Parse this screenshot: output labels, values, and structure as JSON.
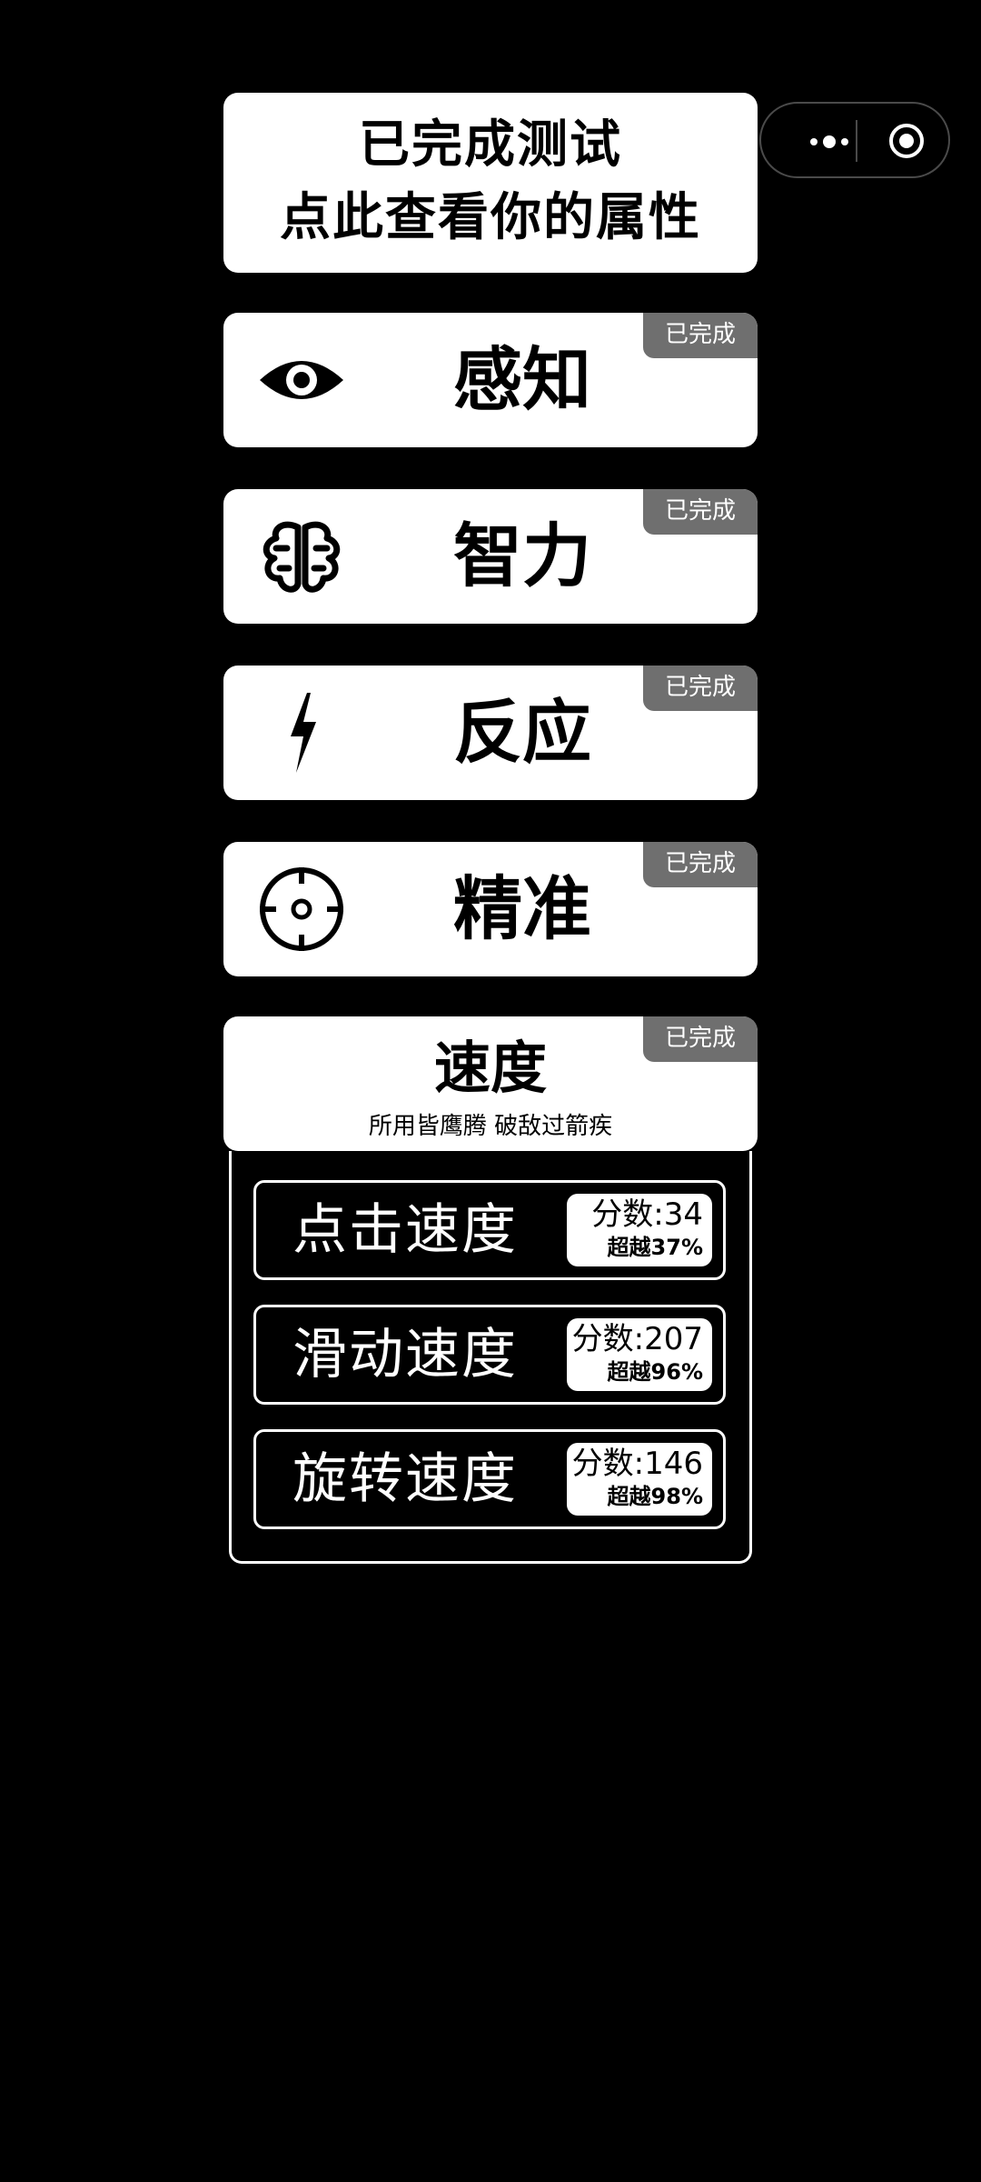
{
  "capsule": {
    "more_icon": "more-icon",
    "close_icon": "target-icon"
  },
  "banner": {
    "line1": "已完成测试",
    "line2": "点此查看你的属性"
  },
  "tests": [
    {
      "name": "感知",
      "badge": "已完成",
      "icon": "eye-icon"
    },
    {
      "name": "智力",
      "badge": "已完成",
      "icon": "brain-icon"
    },
    {
      "name": "反应",
      "badge": "已完成",
      "icon": "lightning-icon"
    },
    {
      "name": "精准",
      "badge": "已完成",
      "icon": "crosshair-icon"
    }
  ],
  "speed": {
    "title": "速度",
    "subtitle": "所用皆鹰腾 破敌过箭疾",
    "badge": "已完成",
    "items": [
      {
        "label": "点击速度",
        "score": "分数:34",
        "beat": "超越37%"
      },
      {
        "label": "滑动速度",
        "score": "分数:207",
        "beat": "超越96%"
      },
      {
        "label": "旋转速度",
        "score": "分数:146",
        "beat": "超越98%"
      }
    ]
  },
  "colors": {
    "background": "#000000",
    "card": "#ffffff",
    "badge": "#6f6f6f"
  }
}
